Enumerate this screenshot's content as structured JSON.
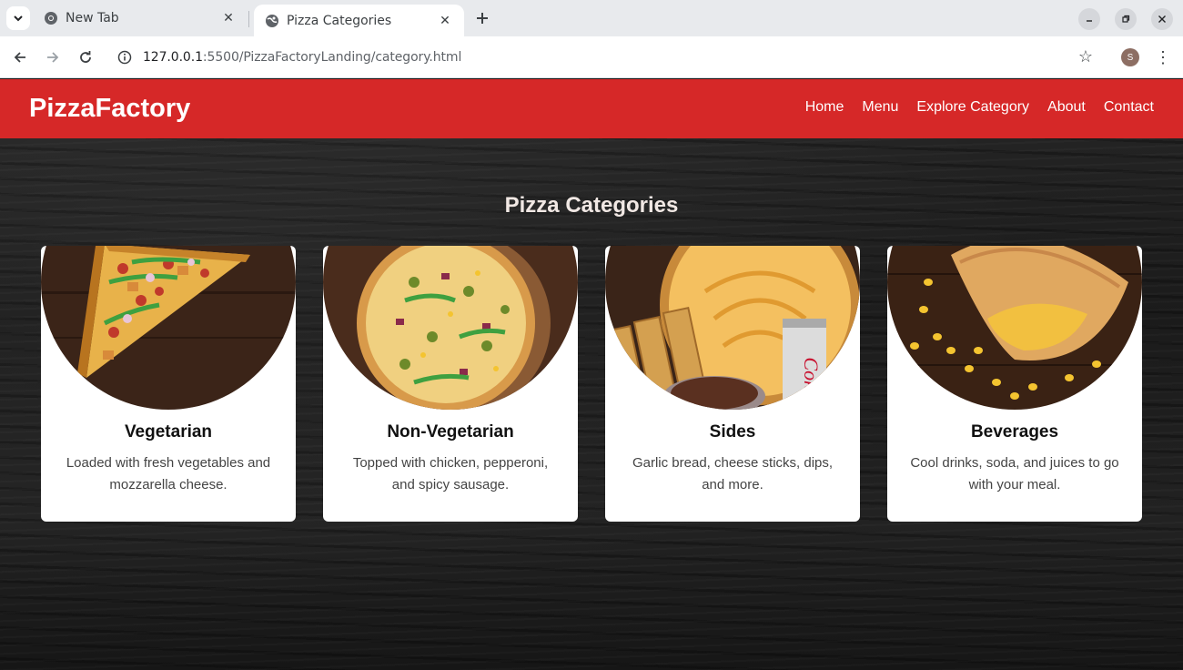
{
  "browser": {
    "tabs": [
      {
        "title": "New Tab",
        "active": false
      },
      {
        "title": "Pizza Categories",
        "active": true
      }
    ],
    "url_host": "127.0.0.1",
    "url_path": ":5500/PizzaFactoryLanding/category.html",
    "profile_initial": "S"
  },
  "site": {
    "brand": "PizzaFactory",
    "nav": [
      "Home",
      "Menu",
      "Explore Category",
      "About",
      "Contact"
    ],
    "nav_color": "#d62828"
  },
  "section": {
    "title": "Pizza Categories"
  },
  "categories": [
    {
      "title": "Vegetarian",
      "description": "Loaded with fresh vegetables and mozzarella cheese.",
      "image": "pizza-slice-veg"
    },
    {
      "title": "Non-Vegetarian",
      "description": "Topped with chicken, pepperoni, and spicy sausage.",
      "image": "whole-pizza"
    },
    {
      "title": "Sides",
      "description": "Garlic bread, cheese sticks, dips, and more.",
      "image": "sides-platter"
    },
    {
      "title": "Beverages",
      "description": "Cool drinks, soda, and juices to go with your meal.",
      "image": "calzone-corn"
    }
  ]
}
